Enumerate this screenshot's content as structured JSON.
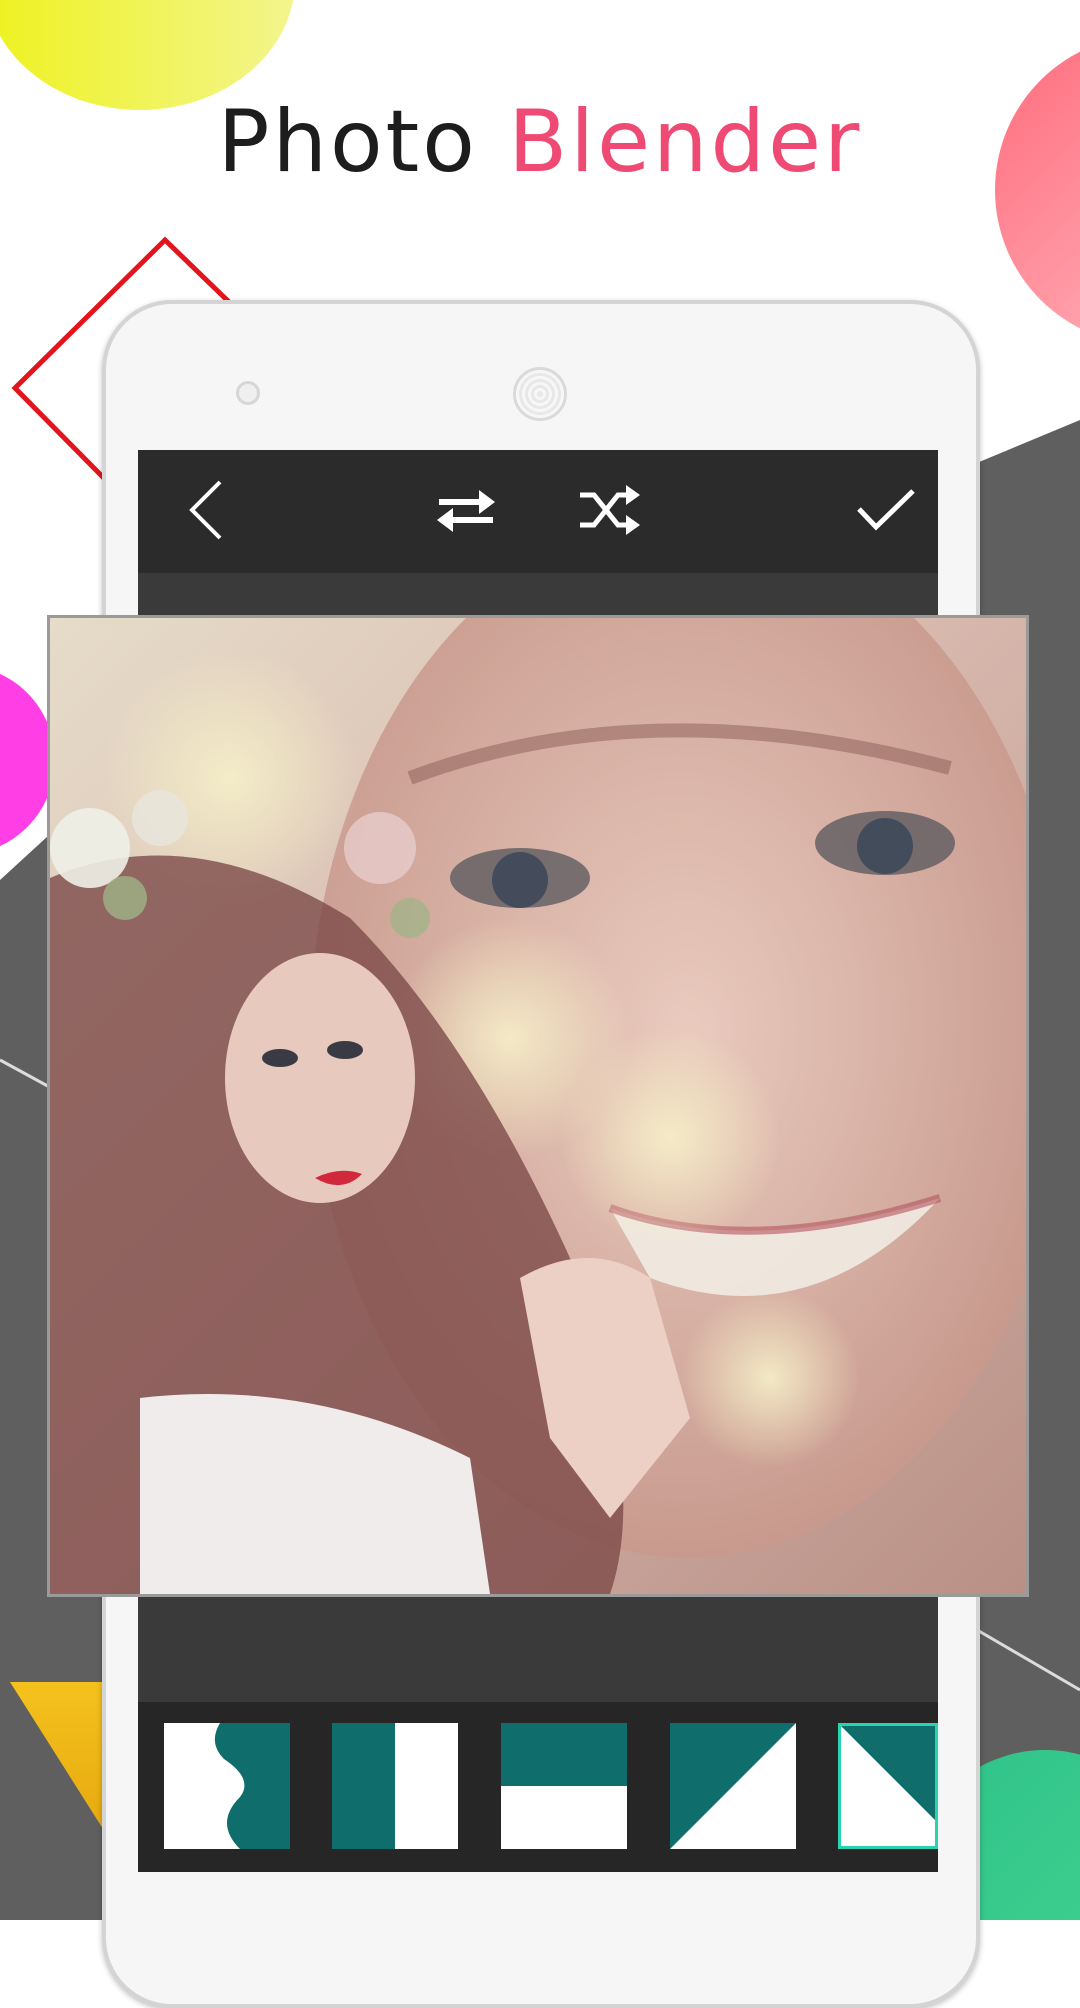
{
  "header": {
    "title_word1": "Photo",
    "title_word2": "Blender"
  },
  "toolbar": {
    "back_icon": "chevron-left-icon",
    "swap_icon": "swap-arrows-icon",
    "shuffle_icon": "shuffle-icon",
    "confirm_icon": "check-icon"
  },
  "thumbnails": [
    {
      "name": "wave-split"
    },
    {
      "name": "vertical-split"
    },
    {
      "name": "horizontal-split"
    },
    {
      "name": "diagonal-split"
    },
    {
      "name": "diagonal-split-selected",
      "selected": true
    }
  ],
  "colors": {
    "accent": "#ee4a73",
    "teal": "#0f6e6b",
    "selected_border": "#2ad3b0",
    "toolbar_bg": "#2b2b2b"
  }
}
